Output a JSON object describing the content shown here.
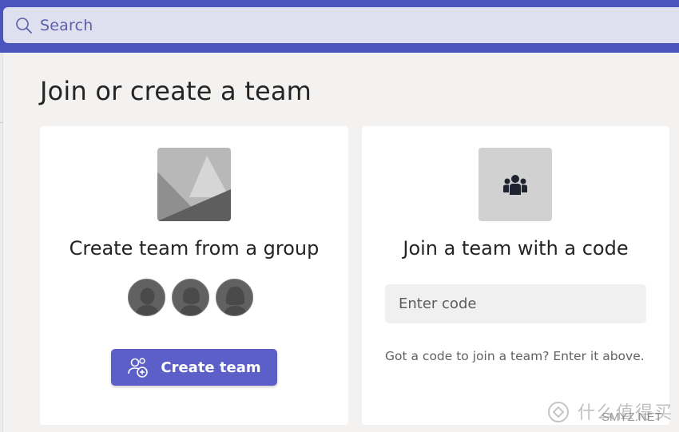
{
  "search": {
    "placeholder": "Search"
  },
  "page": {
    "title": "Join or create a team"
  },
  "create_card": {
    "title": "Create team from a group",
    "button_label": "Create team"
  },
  "join_card": {
    "title": "Join a team with a code",
    "input_placeholder": "Enter code",
    "hint": "Got a code to join a team? Enter it above."
  },
  "watermark": {
    "cn": "什么值得买",
    "en": "SMYZ.NET"
  },
  "colors": {
    "topbar": "#4b53bc",
    "search_bg": "#dfe0ef",
    "accent": "#5b5fc7",
    "page_bg": "#f3f2f1",
    "card_bg": "#ffffff"
  },
  "icons": {
    "search": "search-icon",
    "image": "image-placeholder-icon",
    "people": "people-team-icon",
    "avatar": "person-avatar-icon",
    "add_people": "people-add-icon"
  }
}
